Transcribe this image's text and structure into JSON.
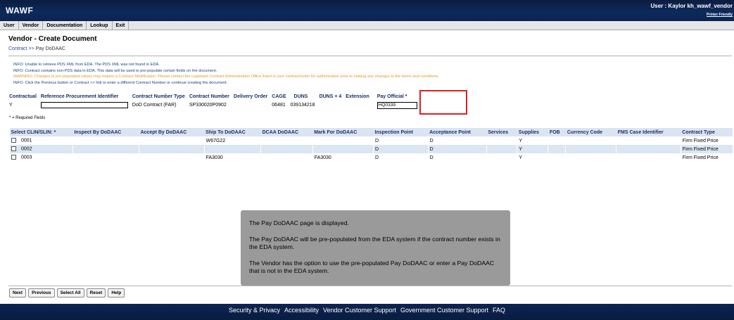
{
  "header": {
    "logo": "WAWF",
    "user": "User : Kaylor kh_wawf_vendor",
    "printer_friendly": "Printer Friendly"
  },
  "menu": [
    "User",
    "Vendor",
    "Documentation",
    "Lookup",
    "Exit"
  ],
  "page_title": "Vendor - Create Document",
  "breadcrumb": {
    "link": "Contract",
    "sep": ">>",
    "current": "Pay DoDAAC"
  },
  "messages": [
    {
      "type": "info",
      "text": "INFO: Unable to retrieve PDS XML from EDA. The PDS XML was not found in EDA."
    },
    {
      "type": "info",
      "text": "INFO: Contract contains non-PDS data in EDA. This data will be used to pre-populate certain fields on the document."
    },
    {
      "type": "warn",
      "text": "WARNING: Changes to pre-populated values may require a Contract Modification. Please contact the cognizant Contract Administration Office listed in your contract/order for authorization prior to making any changes to the terms and conditions."
    },
    {
      "type": "info",
      "text": "INFO: Click the Previous button or Contract >> link to enter a different Contract Number or continue creating the document."
    }
  ],
  "contract_table": {
    "headers": [
      "Contractual",
      "Reference Procurement Identifier",
      "Contract Number Type",
      "Contract Number",
      "Delivery Order",
      "CAGE",
      "DUNS",
      "DUNS + 4",
      "Extension",
      "Pay Official *"
    ],
    "row": {
      "contractual": "Y",
      "reference_procurement_identifier": "",
      "contract_number_type": "DoD Contract (FAR)",
      "contract_number": "SP330020P0902",
      "delivery_order": "",
      "cage": "06481",
      "duns": "039134218",
      "duns4": "",
      "extension": "",
      "pay_official": "HQ0339"
    }
  },
  "required_note": "* = Required Fields",
  "clin_table": {
    "headers": [
      "Select CLIN/SLIN: *",
      "Inspect By DoDAAC",
      "Accept By DoDAAC",
      "Ship To DoDAAC",
      "DCAA DoDAAC",
      "Mark For DoDAAC",
      "Inspection Point",
      "Acceptance Point",
      "Services",
      "Supplies",
      "FOB",
      "Currency Code",
      "FMS Case Identifier",
      "Contract Type"
    ],
    "rows": [
      {
        "clin": "0001",
        "inspect": "",
        "accept": "",
        "ship_to": "W67G22",
        "dcaa": "",
        "mark_for": "",
        "inspection_point": "D",
        "acceptance_point": "D",
        "services": "",
        "supplies": "Y",
        "fob": "",
        "currency": "",
        "fms": "",
        "contract_type": "Firm Fixed Price"
      },
      {
        "clin": "0002",
        "inspect": "",
        "accept": "",
        "ship_to": "",
        "dcaa": "",
        "mark_for": "",
        "inspection_point": "D",
        "acceptance_point": "D",
        "services": "",
        "supplies": "Y",
        "fob": "",
        "currency": "",
        "fms": "",
        "contract_type": "Firm Fixed Price"
      },
      {
        "clin": "0003",
        "inspect": "",
        "accept": "",
        "ship_to": "FA3030",
        "dcaa": "",
        "mark_for": "FA3030",
        "inspection_point": "D",
        "acceptance_point": "D",
        "services": "",
        "supplies": "Y",
        "fob": "",
        "currency": "",
        "fms": "",
        "contract_type": "Firm Fixed Price"
      }
    ]
  },
  "overlay": [
    "The Pay DoDAAC page is displayed.",
    "The Pay DoDAAC will be pre-populated from the EDA system if the contract number exists in the EDA system.",
    "The Vendor has the option to use the pre-populated Pay DoDAAC or enter a Pay DoDAAC that is not in the EDA system."
  ],
  "buttons": [
    "Next",
    "Previous",
    "Select All",
    "Reset",
    "Help"
  ],
  "footer": [
    "Security & Privacy",
    "Accessibility",
    "Vendor Customer Support",
    "Government Customer Support",
    "FAQ"
  ],
  "colors": {
    "header_bg": "#0d2a5e",
    "info_text": "#1a3f8e",
    "warning_text": "#e6982b",
    "highlight_box": "#e02020",
    "overlay_bg": "#9a9a9a"
  }
}
